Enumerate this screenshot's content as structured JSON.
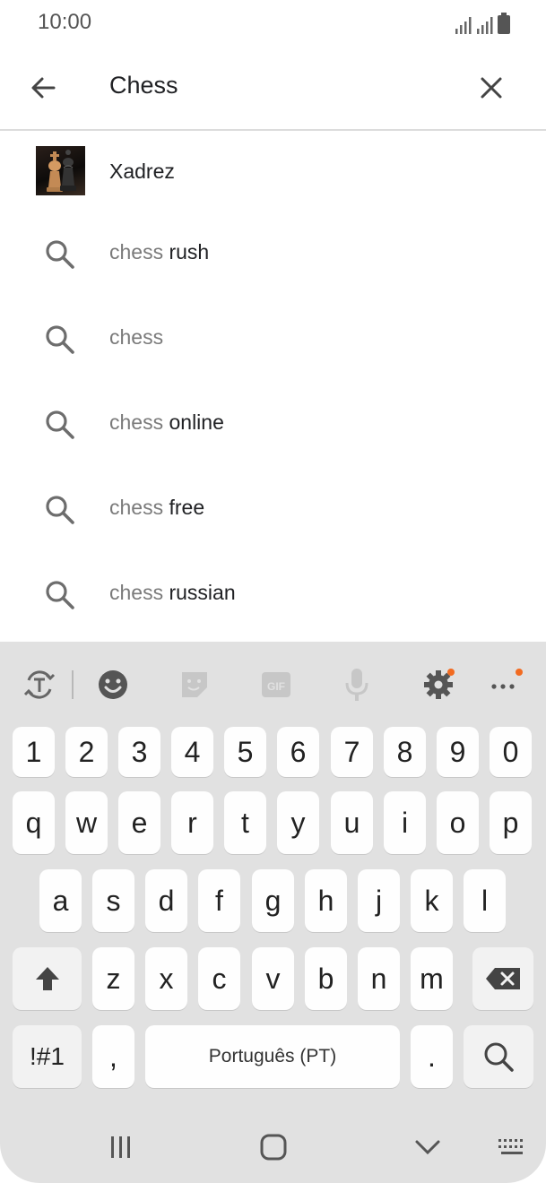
{
  "status": {
    "time": "10:00"
  },
  "search": {
    "query": "Chess"
  },
  "app_result": {
    "name": "Xadrez"
  },
  "suggestions": [
    {
      "prefix": "chess",
      "suffix": " rush"
    },
    {
      "prefix": "chess",
      "suffix": ""
    },
    {
      "prefix": "chess",
      "suffix": " online"
    },
    {
      "prefix": "chess",
      "suffix": " free"
    },
    {
      "prefix": "chess",
      "suffix": " russian"
    }
  ],
  "keyboard": {
    "numbers": [
      "1",
      "2",
      "3",
      "4",
      "5",
      "6",
      "7",
      "8",
      "9",
      "0"
    ],
    "row_q": [
      "q",
      "w",
      "e",
      "r",
      "t",
      "y",
      "u",
      "i",
      "o",
      "p"
    ],
    "row_a": [
      "a",
      "s",
      "d",
      "f",
      "g",
      "h",
      "j",
      "k",
      "l"
    ],
    "row_z": [
      "z",
      "x",
      "c",
      "v",
      "b",
      "n",
      "m"
    ],
    "symbols_label": "!#1",
    "comma": ",",
    "space_label": "Português (PT)",
    "period": ".",
    "toolbar_icons": [
      "text-translate-icon",
      "emoji-icon",
      "sticker-icon",
      "gif-icon",
      "microphone-icon",
      "gear-icon",
      "more-icon"
    ]
  },
  "colors": {
    "accent_dot": "#f26b21",
    "keyboard_bg": "#e1e1e1",
    "key_bg": "#fefefe"
  }
}
